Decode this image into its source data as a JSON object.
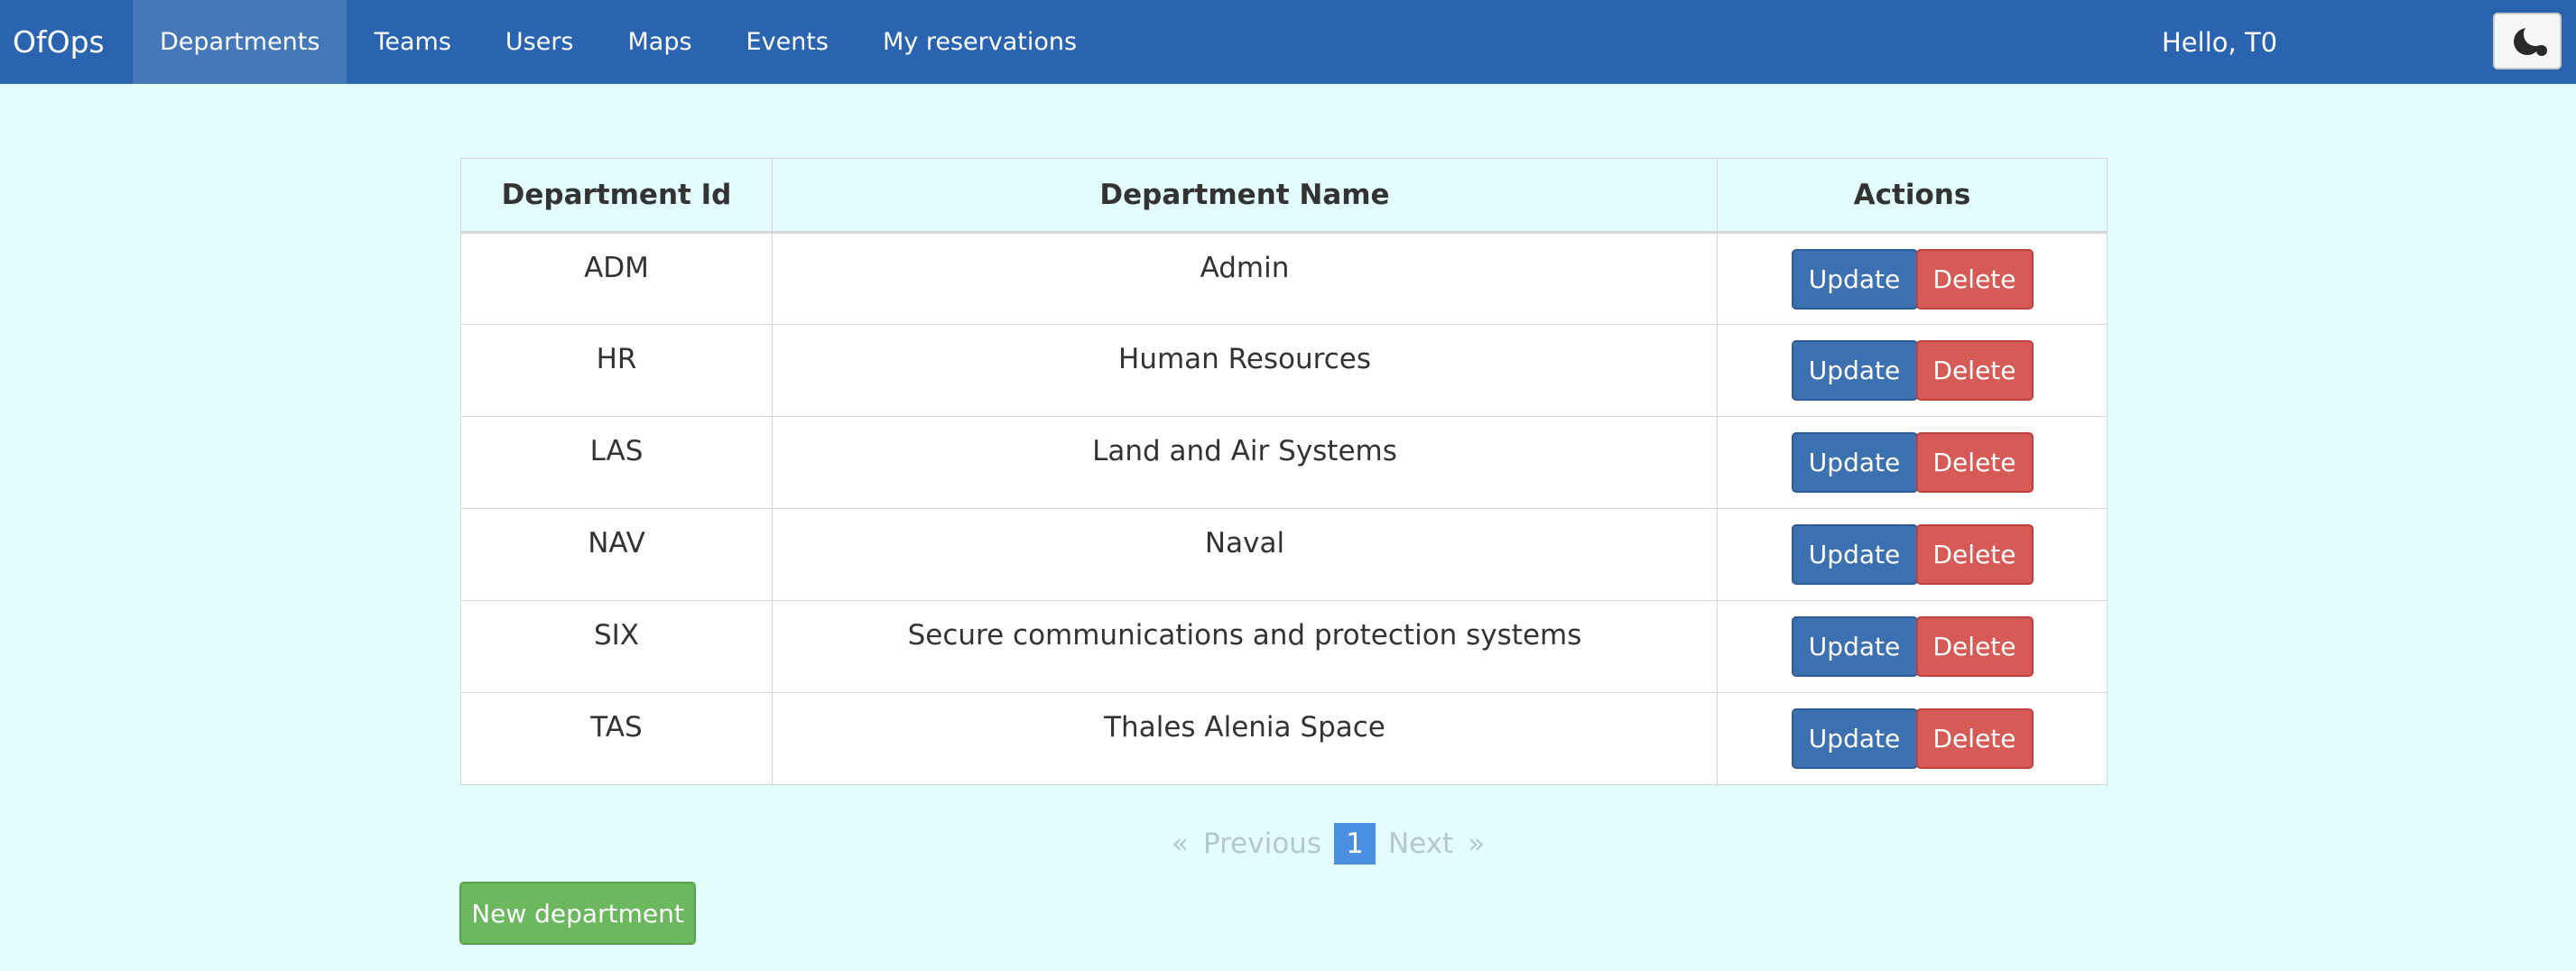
{
  "nav": {
    "brand": "OfOps",
    "items": [
      {
        "label": "Departments",
        "active": true
      },
      {
        "label": "Teams",
        "active": false
      },
      {
        "label": "Users",
        "active": false
      },
      {
        "label": "Maps",
        "active": false
      },
      {
        "label": "Events",
        "active": false
      },
      {
        "label": "My reservations",
        "active": false
      }
    ],
    "greeting": "Hello, T0",
    "theme_toggle_icon": "moon-icon"
  },
  "table": {
    "headers": [
      "Department Id",
      "Department Name",
      "Actions"
    ],
    "rows": [
      {
        "id": "ADM",
        "name": "Admin"
      },
      {
        "id": "HR",
        "name": "Human Resources"
      },
      {
        "id": "LAS",
        "name": "Land and Air Systems"
      },
      {
        "id": "NAV",
        "name": "Naval"
      },
      {
        "id": "SIX",
        "name": "Secure communications and protection systems"
      },
      {
        "id": "TAS",
        "name": "Thales Alenia Space"
      }
    ],
    "update_label": "Update",
    "delete_label": "Delete"
  },
  "pagination": {
    "first": "«",
    "previous": "Previous",
    "current": "1",
    "next": "Next",
    "last": "»"
  },
  "new_button_label": "New department",
  "colors": {
    "navbar": "#2a64b0",
    "background": "#e3fdfd",
    "update": "#3b71b1",
    "delete": "#d65a55",
    "new": "#6bb85e",
    "page_current": "#4a90e2"
  }
}
